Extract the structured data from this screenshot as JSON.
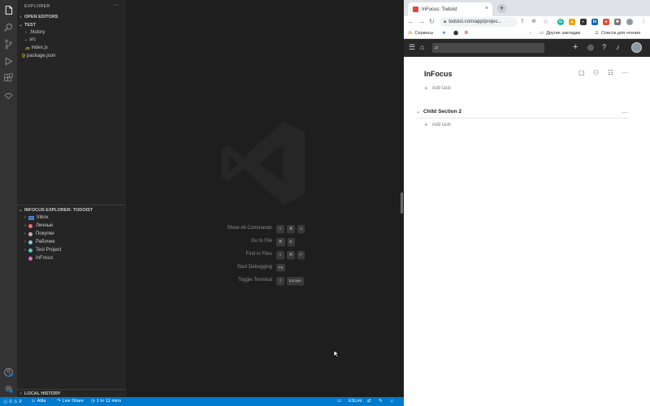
{
  "vscode": {
    "sidebar": {
      "title": "EXPLORER",
      "more": "···",
      "open_editors": "OPEN EDITORS",
      "workspace": "TEST",
      "files": [
        {
          "name": ".history",
          "kind": "folder"
        },
        {
          "name": "src",
          "kind": "folder-open"
        },
        {
          "name": "index.js",
          "kind": "js"
        },
        {
          "name": "package.json",
          "kind": "json"
        }
      ],
      "todoist_explorer": "INFOCUS EXPLORER: TODOIST",
      "projects": [
        {
          "name": "Inbox",
          "color": "#4a90e2"
        },
        {
          "name": "Личные",
          "color": "#ff6b6b"
        },
        {
          "name": "Покупки",
          "color": "#d9a7a7"
        },
        {
          "name": "Рабочие",
          "color": "#8ec3e6"
        },
        {
          "name": "Test Project",
          "color": "#4ccfc0"
        },
        {
          "name": "InFocus",
          "color": "#e866c8"
        }
      ],
      "local_history": "LOCAL HISTORY"
    },
    "commands": [
      {
        "label": "Show All Commands",
        "keys": [
          "⇧",
          "⌘",
          "A"
        ]
      },
      {
        "label": "Go to File",
        "keys": [
          "⌘",
          "E"
        ]
      },
      {
        "label": "Find in Files",
        "keys": [
          "⇧",
          "⌘",
          "F"
        ]
      },
      {
        "label": "Start Debugging",
        "keys": [
          "F5"
        ]
      },
      {
        "label": "Toggle Terminal",
        "keys": [
          "⇧",
          "Escape"
        ]
      }
    ],
    "statusbar": {
      "errors": "0",
      "warnings": "0",
      "user": "Atila",
      "live_share": "Live Share",
      "time": "1 hr 12 mins",
      "eslint": "ESLint"
    },
    "colors": {
      "accent": "#007acc",
      "activity": "#333333",
      "sidebar": "#252526"
    }
  },
  "browser": {
    "tab_title": "InFocus: Todoist",
    "url": "todoist.com/app/projec...",
    "bookmarks": {
      "services": "Сервисы",
      "other": "Другие закладки",
      "reading_list": "Список для чтения"
    }
  },
  "todoist": {
    "project_title": "InFocus",
    "add_task": "Add task",
    "section": "Child Section 2",
    "add_task_2": "Add task",
    "brand_color": "#db4c3f"
  }
}
